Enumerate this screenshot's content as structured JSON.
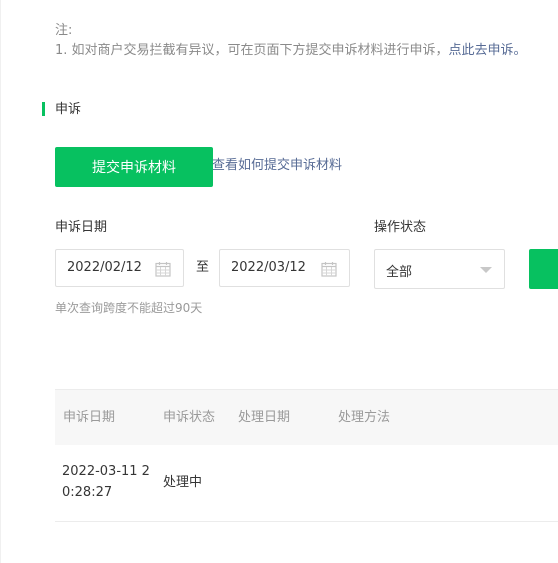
{
  "notice": {
    "title": "注:",
    "line_prefix": "1.  如对商户交易拦截有异议，可在页面下方提交申诉材料进行申诉，",
    "link": "点此去申诉。"
  },
  "section": {
    "title": "申诉"
  },
  "actions": {
    "submit_button": "提交申诉材料",
    "help_link": "查看如何提交申诉材料"
  },
  "filters": {
    "date_label": "申诉日期",
    "start_date": "2022/02/12",
    "separator": "至",
    "end_date": "2022/03/12",
    "status_label": "操作状态",
    "status_value": "全部",
    "hint": "单次查询跨度不能超过90天"
  },
  "colors": {
    "accent": "#07c160",
    "link": "#576b95"
  },
  "table": {
    "headers": [
      "申诉日期",
      "申诉状态",
      "处理日期",
      "处理方法"
    ],
    "rows": [
      {
        "date_line1": "2022-03-11 2",
        "date_line2": "0:28:27",
        "status": "处理中",
        "handled_date": "",
        "method": ""
      }
    ]
  }
}
